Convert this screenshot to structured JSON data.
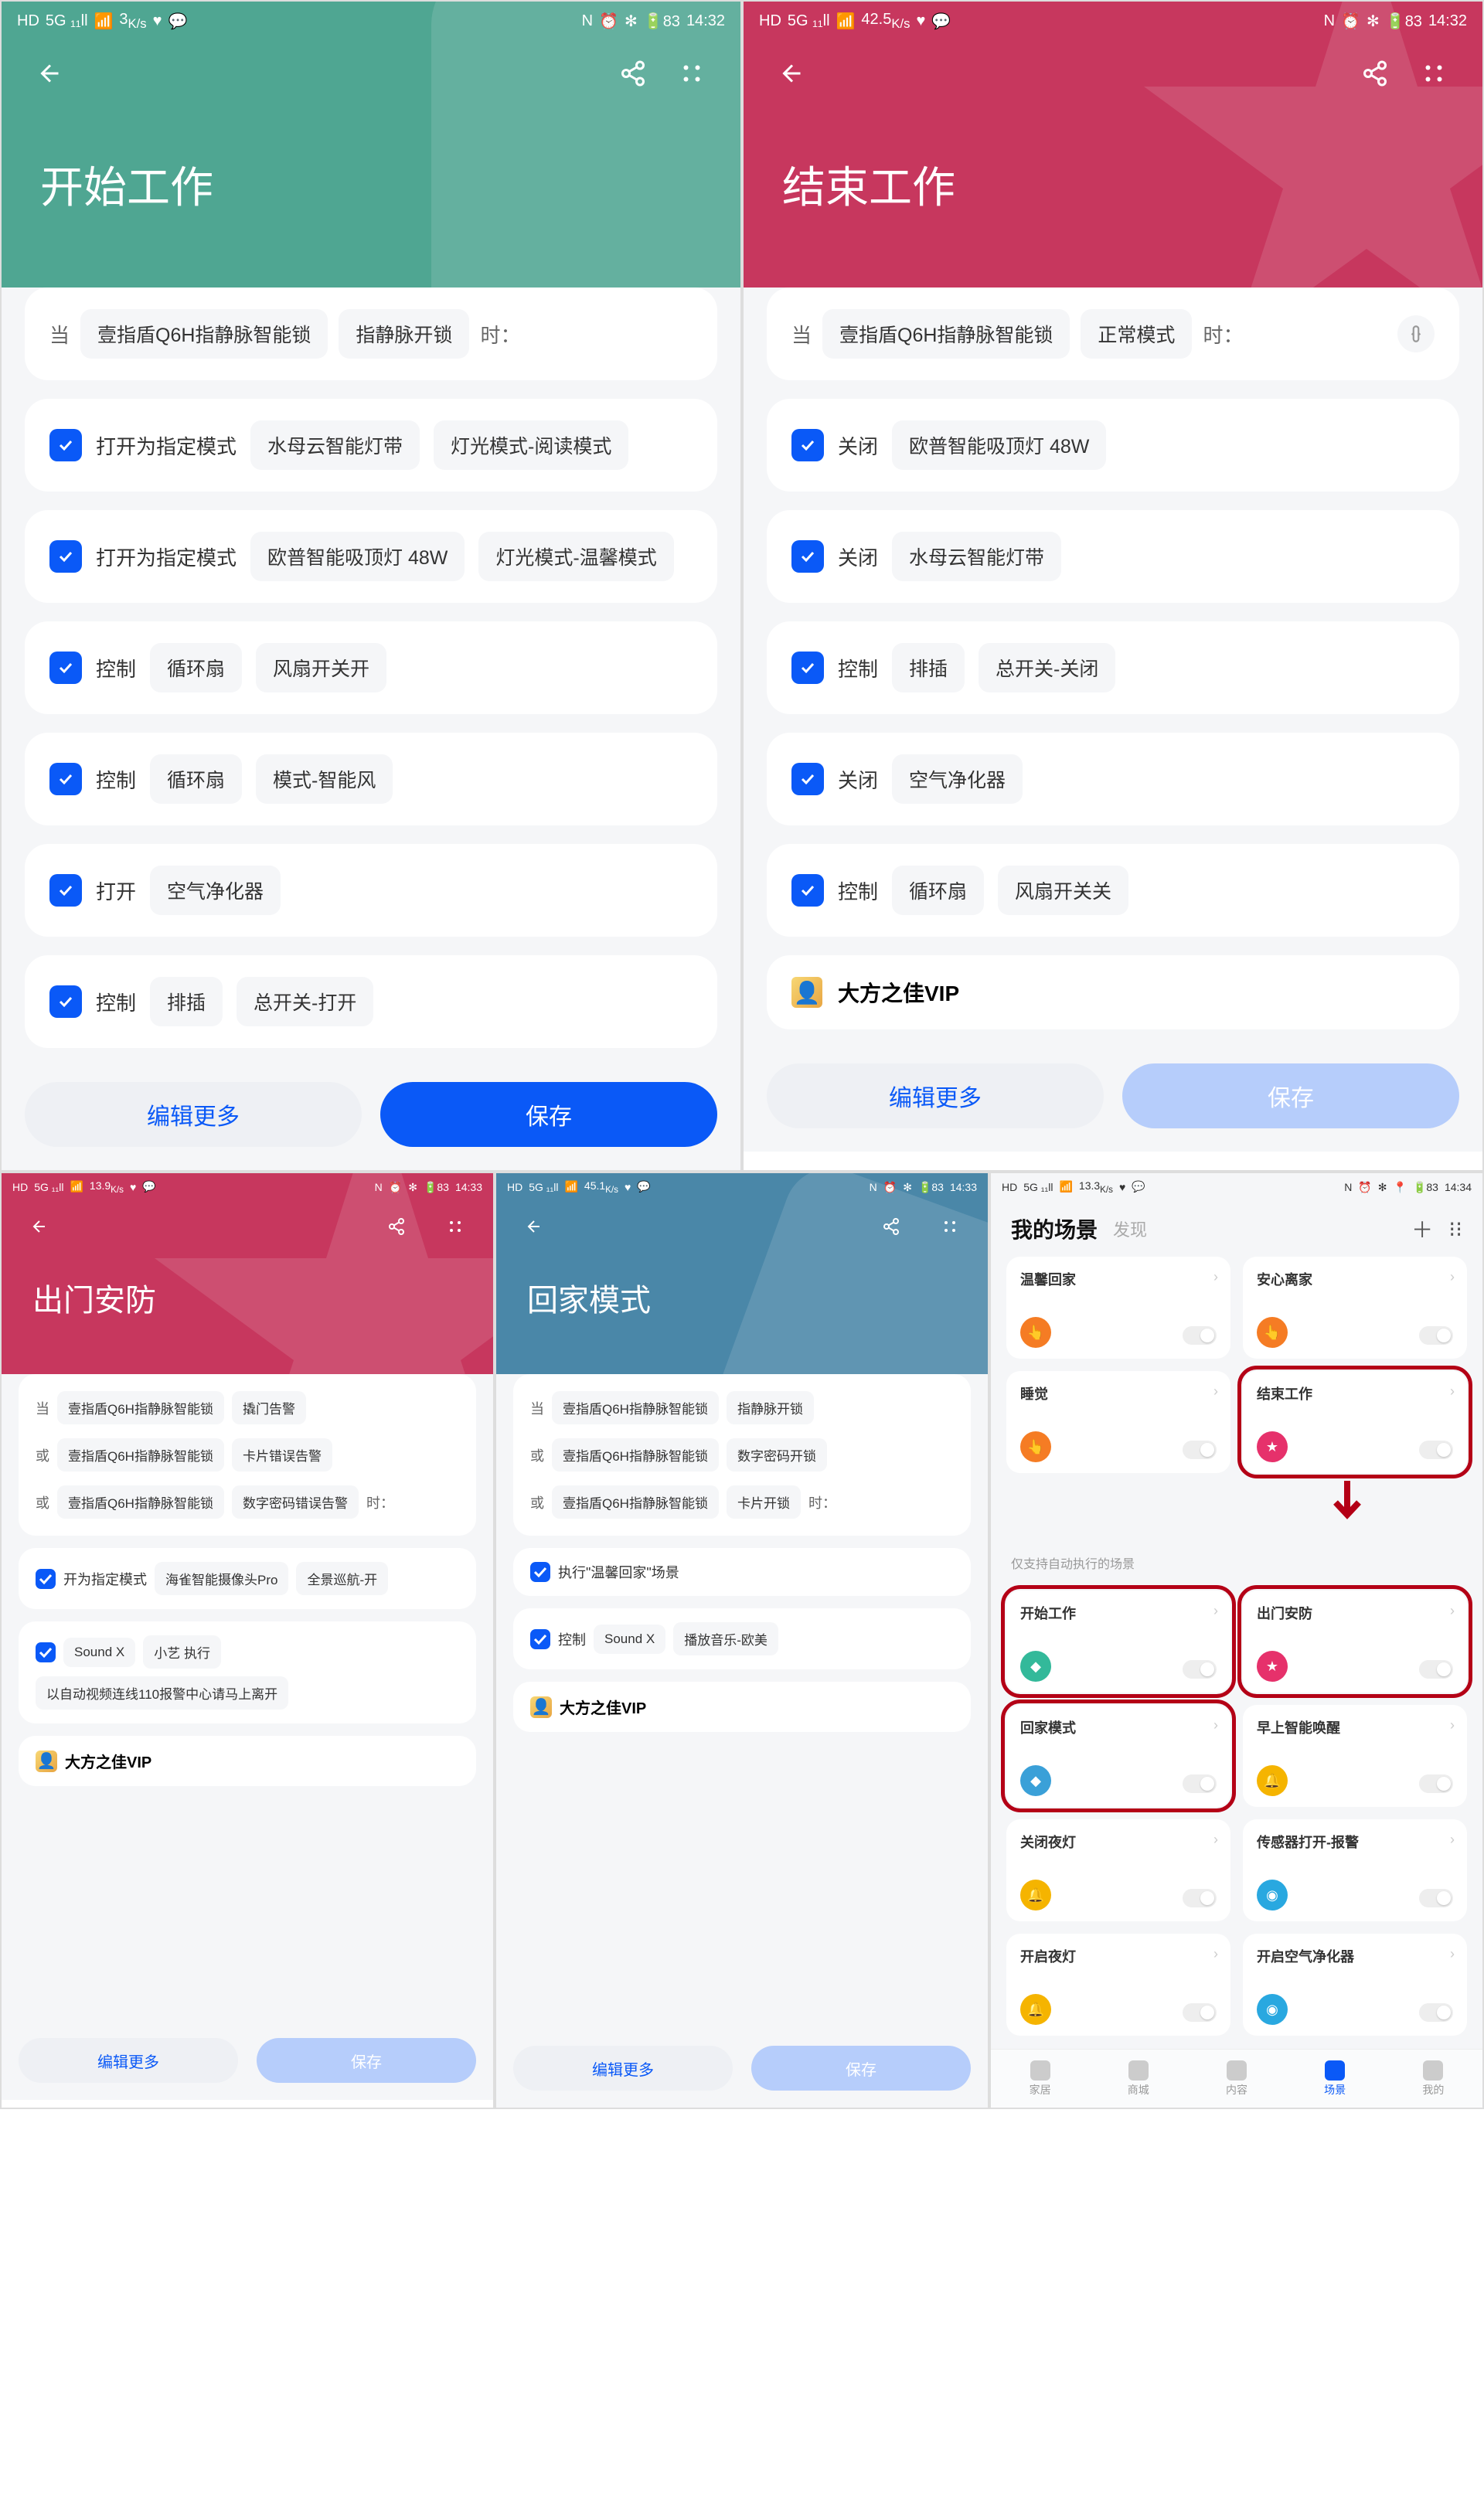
{
  "status": {
    "hd": "HD",
    "sig": "5G ₁₁ll",
    "wifi": "⋮⋮",
    "ks1": "3",
    "ks2": "42.5",
    "ks3": "13.9",
    "ks4": "45.1",
    "ks5": "13.3",
    "ksu": "K/s",
    "heart": "♥",
    "wechat": "⍰",
    "nfc": "N",
    "alarm": "⏰",
    "bt": "✻",
    "batt": "83",
    "time1": "14:32",
    "time2": "14:33",
    "time3": "14:34"
  },
  "phones": {
    "a": {
      "title": "开始工作",
      "cond": {
        "when": "当",
        "dev": "壹指盾Q6H指静脉智能锁",
        "mode": "指静脉开锁",
        "then": "时："
      },
      "actions": [
        {
          "op": "打开为指定模式",
          "p1": "水母云智能灯带",
          "p2": "灯光模式-阅读模式"
        },
        {
          "op": "打开为指定模式",
          "p1": "欧普智能吸顶灯 48W",
          "p2": "灯光模式-温馨模式"
        },
        {
          "op": "控制",
          "p1": "循环扇",
          "p2": "风扇开关开"
        },
        {
          "op": "控制",
          "p1": "循环扇",
          "p2": "模式-智能风"
        },
        {
          "op": "打开",
          "p1": "空气净化器",
          "p2": ""
        },
        {
          "op": "控制",
          "p1": "排插",
          "p2": "总开关-打开"
        }
      ],
      "edit": "编辑更多",
      "save": "保存"
    },
    "b": {
      "title": "结束工作",
      "cond": {
        "when": "当",
        "dev": "壹指盾Q6H指静脉智能锁",
        "mode": "正常模式",
        "then": "时："
      },
      "actions": [
        {
          "op": "关闭",
          "p1": "欧普智能吸顶灯 48W",
          "p2": ""
        },
        {
          "op": "关闭",
          "p1": "水母云智能灯带",
          "p2": ""
        },
        {
          "op": "控制",
          "p1": "排插",
          "p2": "总开关-关闭"
        },
        {
          "op": "关闭",
          "p1": "空气净化器",
          "p2": ""
        },
        {
          "op": "控制",
          "p1": "循环扇",
          "p2": "风扇开关关"
        }
      ],
      "vip": "大方之佳VIP",
      "edit": "编辑更多",
      "save": "保存"
    },
    "c": {
      "title": "出门安防",
      "conds": [
        {
          "pre": "当",
          "dev": "壹指盾Q6H指静脉智能锁",
          "mode": "撬门告警"
        },
        {
          "pre": "或",
          "dev": "壹指盾Q6H指静脉智能锁",
          "mode": "卡片错误告警"
        },
        {
          "pre": "或",
          "dev": "壹指盾Q6H指静脉智能锁",
          "mode": "数字密码错误告警",
          "then": "时："
        }
      ],
      "actions": [
        {
          "op": "开为指定模式",
          "p1": "海雀智能摄像头Pro",
          "p2": "全景巡航-开"
        },
        {
          "op": "",
          "p1": "Sound X",
          "p2": "小艺 执行",
          "p3": "以自动视频连线110报警中心请马上离开"
        }
      ],
      "vip": "大方之佳VIP",
      "edit": "编辑更多",
      "save": "保存"
    },
    "d": {
      "title": "回家模式",
      "conds": [
        {
          "pre": "当",
          "dev": "壹指盾Q6H指静脉智能锁",
          "mode": "指静脉开锁"
        },
        {
          "pre": "或",
          "dev": "壹指盾Q6H指静脉智能锁",
          "mode": "数字密码开锁"
        },
        {
          "pre": "或",
          "dev": "壹指盾Q6H指静脉智能锁",
          "mode": "卡片开锁",
          "then": "时："
        }
      ],
      "actions": [
        {
          "op": "执行\"温馨回家\"场景",
          "p1": "",
          "p2": ""
        },
        {
          "op": "控制",
          "p1": "Sound X",
          "p2": "播放音乐-欧美"
        }
      ],
      "vip": "大方之佳VIP",
      "edit": "编辑更多",
      "save": "保存"
    }
  },
  "scenes": {
    "title": "我的场景",
    "discover": "发现",
    "section": "仅支持自动执行的场景",
    "cards": [
      {
        "name": "温馨回家",
        "color": "#f57c24",
        "glyph": "👆"
      },
      {
        "name": "安心离家",
        "color": "#f57c24",
        "glyph": "👆"
      },
      {
        "name": "睡觉",
        "color": "#f57c24",
        "glyph": "👆"
      },
      {
        "name": "结束工作",
        "color": "#e6316b",
        "glyph": "★",
        "boxed": true
      }
    ],
    "cards2": [
      {
        "name": "开始工作",
        "color": "#33b99a",
        "glyph": "◆",
        "boxed": true
      },
      {
        "name": "出门安防",
        "color": "#e6316b",
        "glyph": "★",
        "boxed": true
      },
      {
        "name": "回家模式",
        "color": "#3aa0d8",
        "glyph": "◆",
        "boxed": true
      },
      {
        "name": "早上智能唤醒",
        "color": "#f5b400",
        "glyph": "🔔"
      },
      {
        "name": "关闭夜灯",
        "color": "#f5b400",
        "glyph": "🔔"
      },
      {
        "name": "传感器打开-报警",
        "color": "#29a8e0",
        "glyph": "◉"
      },
      {
        "name": "开启夜灯",
        "color": "#f5b400",
        "glyph": "🔔"
      },
      {
        "name": "开启空气净化器",
        "color": "#29a8e0",
        "glyph": "◉"
      }
    ],
    "tabs": [
      {
        "label": "家居"
      },
      {
        "label": "商城"
      },
      {
        "label": "内容"
      },
      {
        "label": "场景",
        "active": true
      },
      {
        "label": "我的"
      }
    ]
  }
}
